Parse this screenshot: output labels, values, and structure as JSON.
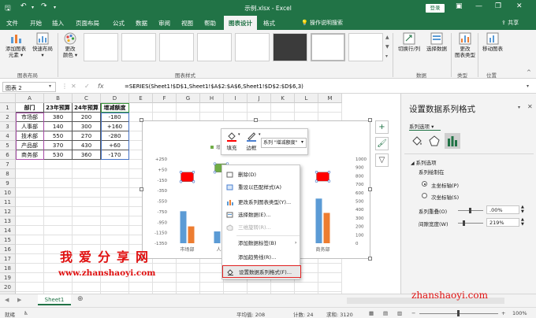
{
  "window": {
    "title": "示例.xlsx  -  Excel",
    "login_label": "登录"
  },
  "tabs": [
    "文件",
    "开始",
    "插入",
    "页面布局",
    "公式",
    "数据",
    "审阅",
    "视图",
    "帮助",
    "图表设计",
    "格式"
  ],
  "active_tab": "图表设计",
  "tell_me": "操作说明搜索",
  "share_label": "共享",
  "ribbon": {
    "add_element": "添加图表\n元素 ▾",
    "quick_layout": "快速布局\n▾",
    "change_color": "更改\n颜色 ▾",
    "switch_row_col": "切换行/列",
    "select_data": "选择数据",
    "change_type": "更改\n图表类型",
    "move_chart": "移动图表",
    "groups": {
      "layout": "图表布局",
      "styles": "图表样式",
      "data": "数据",
      "type": "类型",
      "location": "位置"
    }
  },
  "name_box": "图表 2",
  "formula": "=SERIES(Sheet1!$D$1,Sheet1!$A$2:$A$6,Sheet1!$D$2:$D$6,3)",
  "columns": [
    "A",
    "B",
    "C",
    "D",
    "E",
    "F",
    "G",
    "H",
    "I",
    "J",
    "K",
    "L",
    "M"
  ],
  "rows": [
    "1",
    "2",
    "3",
    "4",
    "5",
    "6",
    "7",
    "8",
    "9",
    "10",
    "11",
    "12",
    "13",
    "14",
    "15",
    "16",
    "17",
    "18",
    "19",
    "20",
    "21"
  ],
  "table": {
    "headers": [
      "部门",
      "23年预算",
      "24年预算",
      "增减额度"
    ],
    "data": [
      [
        "市场部",
        "380",
        "200",
        "-180"
      ],
      [
        "人事部",
        "140",
        "300",
        "+160"
      ],
      [
        "技术部",
        "550",
        "270",
        "-280"
      ],
      [
        "产品部",
        "370",
        "430",
        "+60"
      ],
      [
        "商务部",
        "530",
        "360",
        "-170"
      ]
    ]
  },
  "chart_data": {
    "type": "bar",
    "categories": [
      "市场部",
      "人事部",
      "技术部",
      "产品部",
      "商务部"
    ],
    "series": [
      {
        "name": "23年预算",
        "values": [
          380,
          140,
          550,
          370,
          530
        ],
        "color": "#5b9bd5",
        "axis": "secondary"
      },
      {
        "name": "24年预算",
        "values": [
          200,
          300,
          270,
          430,
          360
        ],
        "color": "#ed7d31",
        "axis": "secondary"
      },
      {
        "name": "增减额度",
        "values": [
          -180,
          160,
          -280,
          60,
          -170
        ],
        "color": "#ff0000",
        "axis": "primary",
        "selected": true
      }
    ],
    "visible_category_labels": [
      "市场部",
      "人事",
      "",
      "",
      "商务部"
    ],
    "left_axis_ticks": [
      "+250",
      "+50",
      "-150",
      "-350",
      "-550",
      "-750",
      "-950",
      "-1150",
      "-1350"
    ],
    "right_axis_ticks": [
      "1000",
      "900",
      "800",
      "700",
      "600",
      "500",
      "400",
      "300",
      "200",
      "100",
      "0"
    ],
    "ylim_left": [
      -1350,
      250
    ],
    "ylim_right": [
      0,
      1000
    ],
    "legend_partial": "增"
  },
  "mini_toolbar": {
    "fill_label": "填充",
    "outline_label": "边框",
    "series_select": "系列 \"增减额度\""
  },
  "context_menu": [
    {
      "label": "删除(D)",
      "disabled": false
    },
    {
      "label": "重设以匹配样式(A)",
      "disabled": false
    },
    {
      "label": "更改系列图表类型(Y)...",
      "disabled": false
    },
    {
      "label": "选择数据(E)...",
      "disabled": false
    },
    {
      "label": "三维旋转(R)...",
      "disabled": true
    },
    {
      "label": "添加数据标签(B)",
      "disabled": false,
      "submenu": true
    },
    {
      "label": "添加趋势线(R)...",
      "disabled": false
    },
    {
      "label": "设置数据系列格式(F)...",
      "disabled": false,
      "highlight": true
    }
  ],
  "pane": {
    "title": "设置数据系列格式",
    "series_options": "系列选项 ▾",
    "section": "系列选项",
    "plot_on": "系列绘制在",
    "primary_axis": "主坐标轴(P)",
    "secondary_axis": "次坐标轴(S)",
    "overlap_label": "系列重叠(O)",
    "overlap_value": ".00%",
    "gap_label": "间隙宽度(W)",
    "gap_value": "219%"
  },
  "sheet_tab": "Sheet1",
  "status": {
    "ready": "就绪",
    "average": "平均值: 208",
    "count": "计数: 24",
    "sum": "求和: 3120",
    "zoom": "100%"
  },
  "watermarks": {
    "cn": "我爱分享网",
    "url": "www.zhanshaoyi.com",
    "corner": "zhanshaoyi.com"
  },
  "colors": {
    "excel_green": "#217346",
    "primary_bar": "#5b9bd5",
    "secondary_bar": "#ed7d31",
    "selected_series": "#ff0000",
    "watermark": "#e01010"
  }
}
